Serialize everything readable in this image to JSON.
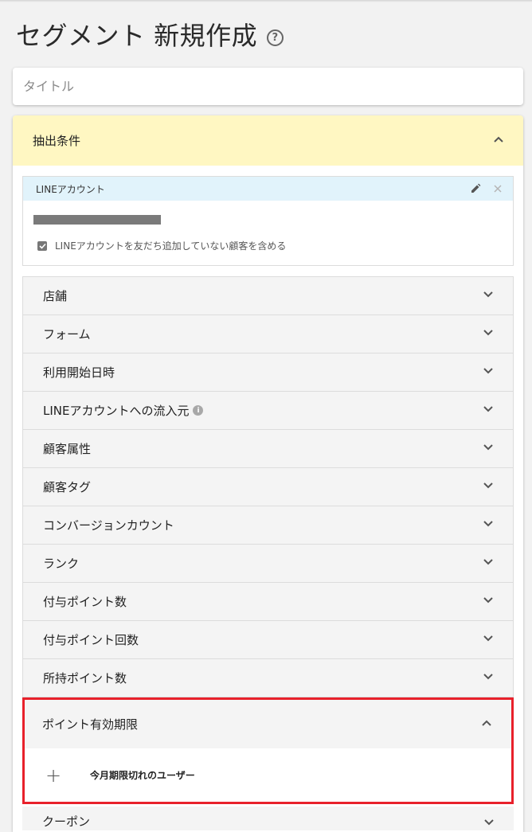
{
  "page": {
    "title": "セグメント 新規作成",
    "help_icon": "?"
  },
  "title_field": {
    "placeholder": "タイトル",
    "value": ""
  },
  "conditions": {
    "header_label": "抽出条件",
    "line_account": {
      "title": "LINEアカウント",
      "include_non_friends_label": "LINEアカウントを友だち追加していない顧客を含める",
      "include_non_friends_checked": true
    },
    "items": [
      {
        "label": "店舗",
        "info": false
      },
      {
        "label": "フォーム",
        "info": false
      },
      {
        "label": "利用開始日時",
        "info": false
      },
      {
        "label": "LINEアカウントへの流入元",
        "info": true
      },
      {
        "label": "顧客属性",
        "info": false
      },
      {
        "label": "顧客タグ",
        "info": false
      },
      {
        "label": "コンバージョンカウント",
        "info": false
      },
      {
        "label": "ランク",
        "info": false
      },
      {
        "label": "付与ポイント数",
        "info": false
      },
      {
        "label": "付与ポイント回数",
        "info": false
      },
      {
        "label": "所持ポイント数",
        "info": false
      }
    ],
    "expanded_item": {
      "label": "ポイント有効期限",
      "options": [
        {
          "label": "今月期限切れのユーザー"
        }
      ]
    },
    "next_item": {
      "label": "クーポン"
    }
  },
  "colors": {
    "header_bg": "#fff7c2",
    "line_head_bg": "#e1f3fb",
    "highlight_border": "#e8212b"
  }
}
